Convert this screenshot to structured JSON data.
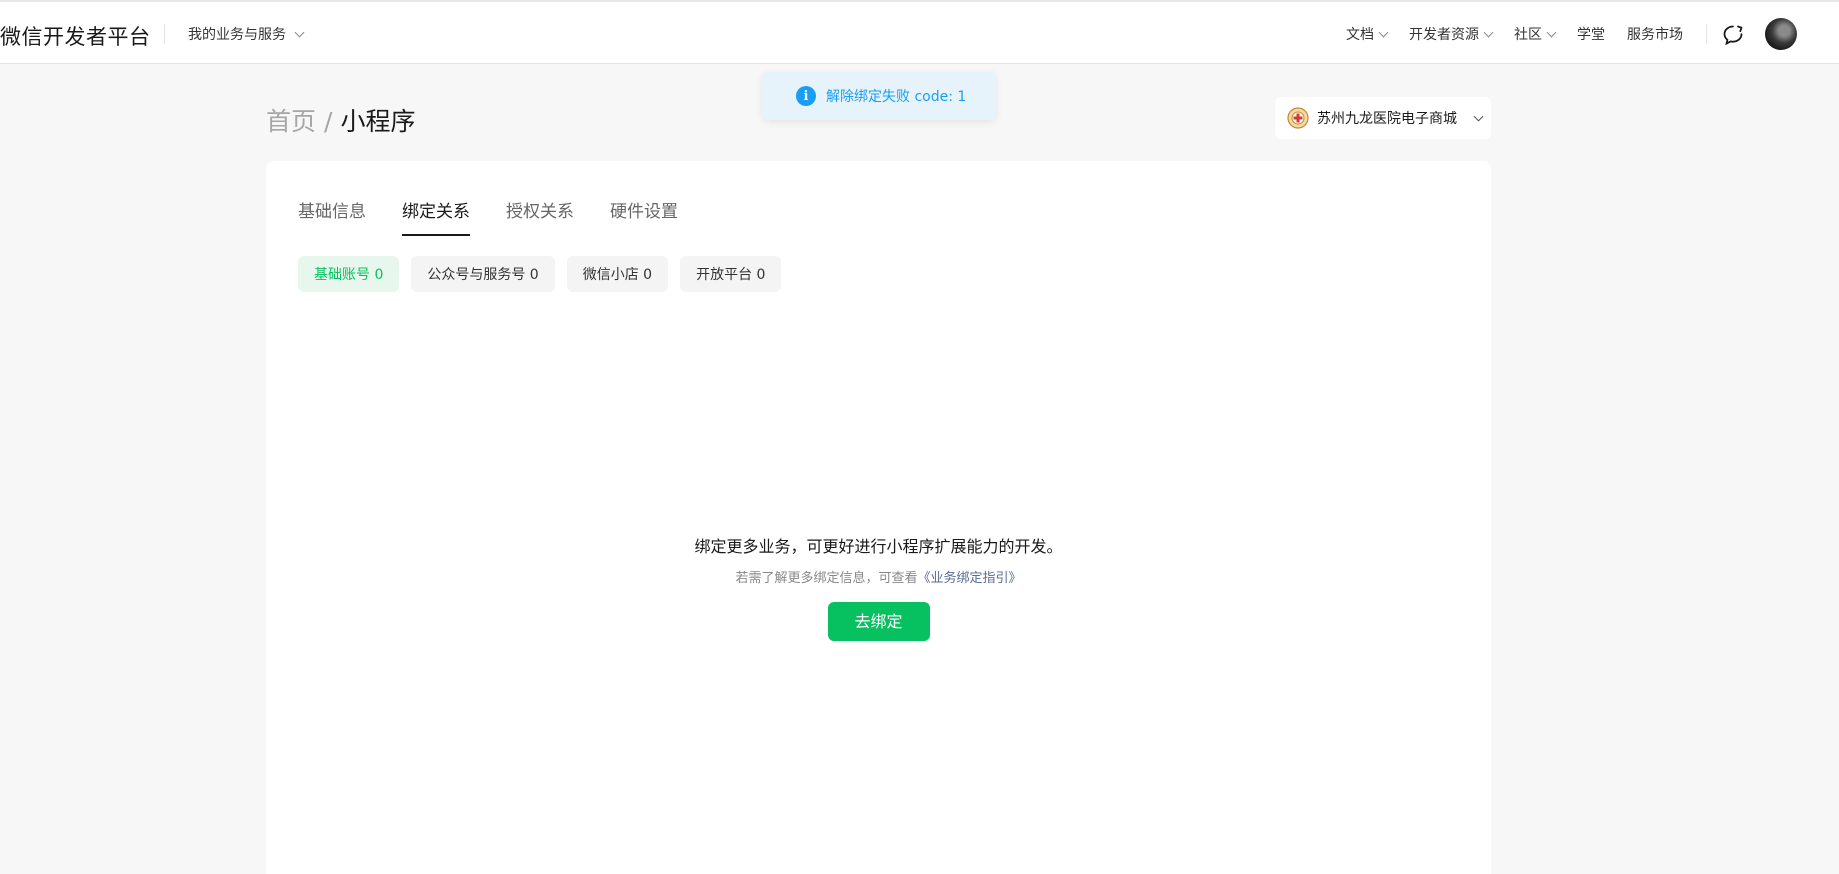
{
  "header": {
    "brand": "微信开发者平台",
    "business_menu": "我的业务与服务",
    "nav": [
      {
        "label": "文档",
        "has_dropdown": true
      },
      {
        "label": "开发者资源",
        "has_dropdown": true
      },
      {
        "label": "社区",
        "has_dropdown": true
      },
      {
        "label": "学堂",
        "has_dropdown": false
      },
      {
        "label": "服务市场",
        "has_dropdown": false
      }
    ],
    "icons": {
      "chat": "chat-bubble-icon",
      "avatar": "user-avatar"
    }
  },
  "toast": {
    "icon": "info-icon",
    "icon_glyph": "i",
    "message": "解除绑定失败 code: 1",
    "color": "#1a9ef5"
  },
  "breadcrumb": {
    "home": "首页",
    "separator": "/",
    "current": "小程序"
  },
  "account": {
    "name": "苏州九龙医院电子商城"
  },
  "tabs": [
    {
      "label": "基础信息",
      "active": false
    },
    {
      "label": "绑定关系",
      "active": true
    },
    {
      "label": "授权关系",
      "active": false
    },
    {
      "label": "硬件设置",
      "active": false
    }
  ],
  "filters": [
    {
      "label": "基础账号 0",
      "active": true
    },
    {
      "label": "公众号与服务号 0",
      "active": false
    },
    {
      "label": "微信小店 0",
      "active": false
    },
    {
      "label": "开放平台 0",
      "active": false
    }
  ],
  "empty_state": {
    "title": "绑定更多业务，可更好进行小程序扩展能力的开发。",
    "sub_prefix": "若需了解更多绑定信息，可查看",
    "sub_link": "《业务绑定指引》",
    "button": "去绑定"
  },
  "colors": {
    "accent_green": "#07c160",
    "link": "#576b95",
    "background": "#f7f7f7"
  }
}
